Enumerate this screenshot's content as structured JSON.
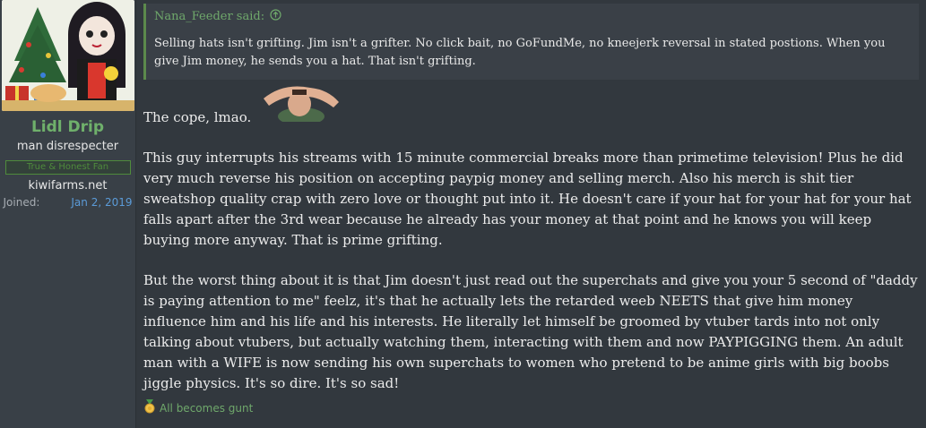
{
  "user": {
    "name": "Lidl Drip",
    "title": "man disrespecter",
    "banner": "True & Honest Fan",
    "site": "kiwifarms.net",
    "joined_label": "Joined:",
    "joined_value": "Jan 2, 2019"
  },
  "quote": {
    "author_said": "Nana_Feeder said:",
    "icon": "arrow-up-circle-icon",
    "text": "Selling hats isn't grifting. Jim isn't a grifter. No click bait, no GoFundMe, no kneejerk reversal in stated postions. When you give Jim money, he sends you a hat. That isn't grifting."
  },
  "post": {
    "line1": "The cope, lmao.",
    "para1": "This guy interrupts his streams with 15 minute commercial breaks more than primetime television! Plus he did very much reverse his position on accepting paypig money and selling merch. Also his merch is shit tier sweatshop quality crap with zero love or thought put into it. He doesn't care if your hat for your hat for your hat falls apart after the 3rd wear because he already has your money at that point and he knows you will keep buying more anyway. That is prime grifting.",
    "para2": "But the worst thing about it is that Jim doesn't just read out the superchats and give you your 5 second of \"daddy is paying attention to me\" feelz, it's that he actually lets the retarded weeb NEETS that give him money influence him and his life and his interests. He literally let himself be groomed by vtuber tards into not only talking about vtubers, but actually watching them, interacting with them and now PAYPIGGING them. An adult man with a WIFE is now sending his own superchats to women who pretend to be anime girls with big boobs jiggle physics. It's so dire. It's so sad!"
  },
  "reaction": {
    "icon": "medal-icon",
    "label": "All becomes gunt"
  },
  "colors": {
    "background": "#32383e",
    "panel": "#394047",
    "username": "#6fb06b",
    "link": "#5b9bd8",
    "quote_border": "#5c8a4c"
  }
}
